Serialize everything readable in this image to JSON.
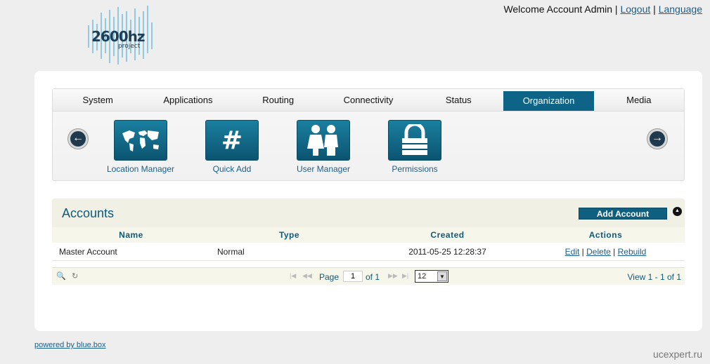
{
  "logo": {
    "text": "2600hz",
    "sub": "project"
  },
  "topbar": {
    "welcome": "Welcome Account Admin |",
    "logout": "Logout",
    "sep": "|",
    "language": "Language"
  },
  "tabs": [
    "System",
    "Applications",
    "Routing",
    "Connectivity",
    "Status",
    "Organization",
    "Media"
  ],
  "active_tab": "Organization",
  "apps": [
    {
      "label": "Location Manager",
      "icon": "world-map-icon"
    },
    {
      "label": "Quick Add",
      "icon": "hash-icon"
    },
    {
      "label": "User Manager",
      "icon": "users-icon"
    },
    {
      "label": "Permissions",
      "icon": "lock-icon"
    }
  ],
  "grid": {
    "title": "Accounts",
    "add_label": "Add Account",
    "columns": [
      "Name",
      "Type",
      "Created",
      "Actions"
    ],
    "rows": [
      {
        "name": "Master Account",
        "type": "Normal",
        "created": "2011-05-25 12:28:37",
        "edit": "Edit",
        "delete": "Delete",
        "rebuild": "Rebuild"
      }
    ],
    "pager": {
      "page_label": "Page",
      "page": "1",
      "of": "of 1",
      "per_page": "12",
      "view": "View 1 - 1 of 1"
    }
  },
  "footer": "powered by blue.box",
  "watermark": "ucexpert.ru",
  "colors": {
    "accent": "#0e6486",
    "link": "#1a5f8a",
    "header_bg": "#f1f0e4"
  }
}
